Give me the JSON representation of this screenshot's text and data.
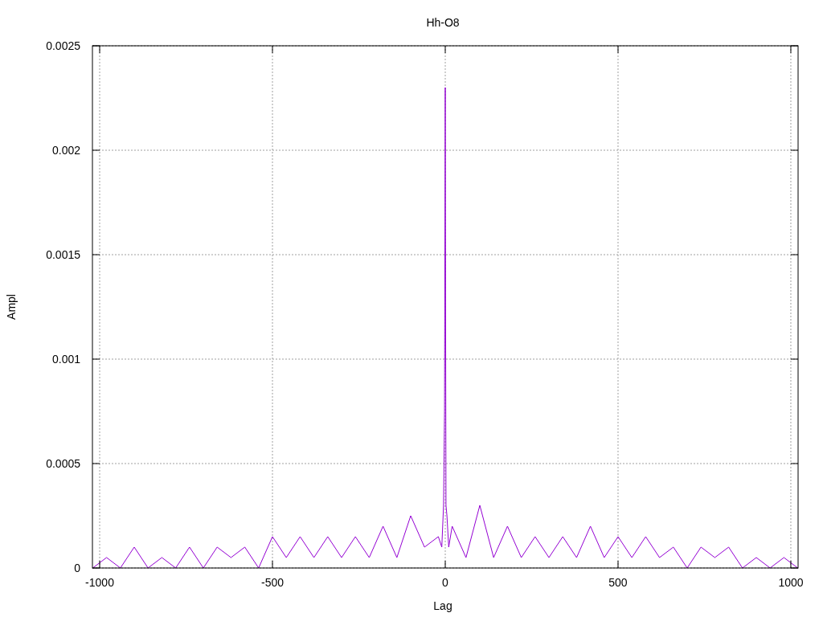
{
  "chart_data": {
    "type": "line",
    "title": "Hh-O8",
    "xlabel": "Lag",
    "ylabel": "Ampl",
    "xlim": [
      -1021,
      1021
    ],
    "ylim": [
      0,
      0.0025
    ],
    "xticks": [
      -1000,
      -500,
      0,
      500,
      1000
    ],
    "yticks": [
      0,
      0.0005,
      0.001,
      0.0015,
      0.002,
      0.0025
    ],
    "grid": true,
    "x": [
      -1020,
      -980,
      -940,
      -900,
      -860,
      -820,
      -780,
      -740,
      -700,
      -660,
      -620,
      -580,
      -540,
      -500,
      -460,
      -420,
      -380,
      -340,
      -300,
      -260,
      -220,
      -180,
      -140,
      -100,
      -60,
      -20,
      -10,
      -5,
      -2,
      -1,
      0,
      1,
      2,
      5,
      10,
      20,
      60,
      100,
      140,
      180,
      220,
      260,
      300,
      340,
      380,
      420,
      460,
      500,
      540,
      580,
      620,
      660,
      700,
      740,
      780,
      820,
      860,
      900,
      940,
      980,
      1020
    ],
    "series": [
      {
        "color": "#9400d3",
        "values": [
          0,
          5e-05,
          0,
          0.0001,
          0,
          5e-05,
          0,
          0.0001,
          0,
          0.0001,
          5e-05,
          0.0001,
          0,
          0.00015,
          5e-05,
          0.00015,
          5e-05,
          0.00015,
          5e-05,
          0.00015,
          5e-05,
          0.0002,
          5e-05,
          0.00025,
          0.0001,
          0.00015,
          0.0001,
          0.0003,
          0.00075,
          0.0016,
          0.0023,
          0.0013,
          0.0003,
          0.00025,
          0.0001,
          0.0002,
          5e-05,
          0.0003,
          5e-05,
          0.0002,
          5e-05,
          0.00015,
          5e-05,
          0.00015,
          5e-05,
          0.0002,
          5e-05,
          0.00015,
          5e-05,
          0.00015,
          5e-05,
          0.0001,
          0,
          0.0001,
          5e-05,
          0.0001,
          0,
          5e-05,
          0,
          5e-05,
          0
        ]
      }
    ]
  }
}
